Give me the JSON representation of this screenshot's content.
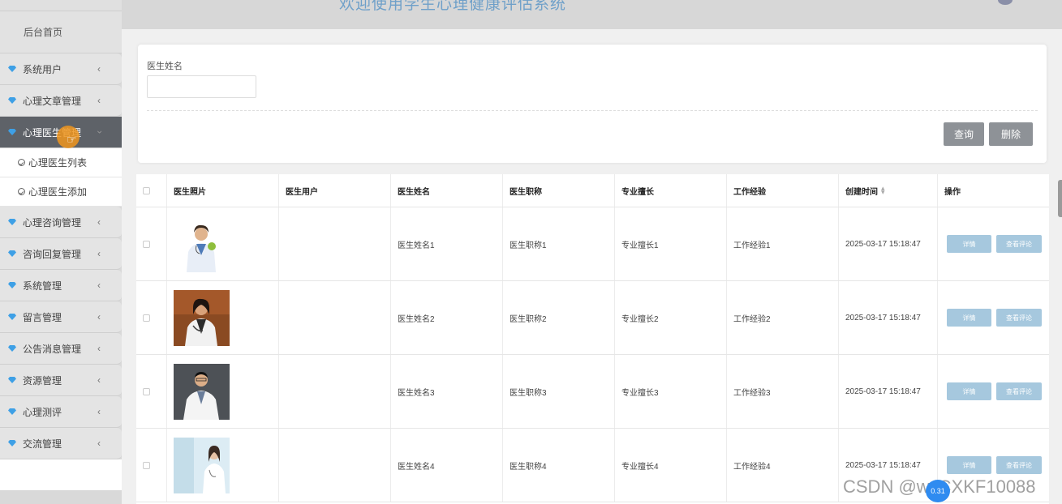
{
  "header": {
    "title": "欢迎使用学生心理健康评估系统"
  },
  "sidebar": {
    "home": "后台首页",
    "items": [
      {
        "label": "系统用户",
        "active": false
      },
      {
        "label": "心理文章管理",
        "active": false
      },
      {
        "label": "心理医生管理",
        "active": true
      },
      {
        "label": "心理咨询管理",
        "active": false
      },
      {
        "label": "咨询回复管理",
        "active": false
      },
      {
        "label": "系统管理",
        "active": false
      },
      {
        "label": "留言管理",
        "active": false
      },
      {
        "label": "公告消息管理",
        "active": false
      },
      {
        "label": "资源管理",
        "active": false
      },
      {
        "label": "心理测评",
        "active": false
      },
      {
        "label": "交流管理",
        "active": false
      }
    ],
    "subitems": [
      "心理医生列表",
      "心理医生添加"
    ]
  },
  "search": {
    "label": "医生姓名",
    "value": "",
    "query_button": "查询",
    "delete_button": "删除"
  },
  "table": {
    "columns": [
      "医生照片",
      "医生用户",
      "医生姓名",
      "医生职称",
      "专业擅长",
      "工作经验",
      "创建时间",
      "操作"
    ],
    "rows": [
      {
        "user": "",
        "name": "医生姓名1",
        "title": "医生职称1",
        "specialty": "专业擅长1",
        "experience": "工作经验1",
        "created": "2025-03-17 15:18:47",
        "detail": "详情",
        "comment": "查看评论"
      },
      {
        "user": "",
        "name": "医生姓名2",
        "title": "医生职称2",
        "specialty": "专业擅长2",
        "experience": "工作经验2",
        "created": "2025-03-17 15:18:47",
        "detail": "详情",
        "comment": "查看评论"
      },
      {
        "user": "",
        "name": "医生姓名3",
        "title": "医生职称3",
        "specialty": "专业擅长3",
        "experience": "工作经验3",
        "created": "2025-03-17 15:18:47",
        "detail": "详情",
        "comment": "查看评论"
      },
      {
        "user": "",
        "name": "医生姓名4",
        "title": "医生职称4",
        "specialty": "专业擅长4",
        "experience": "工作经验4",
        "created": "2025-03-17 15:18:47",
        "detail": "详情",
        "comment": "查看评论"
      }
    ]
  },
  "overlay": {
    "watermark": "CSDN @wxCXKF10088",
    "badge": "0.31"
  }
}
